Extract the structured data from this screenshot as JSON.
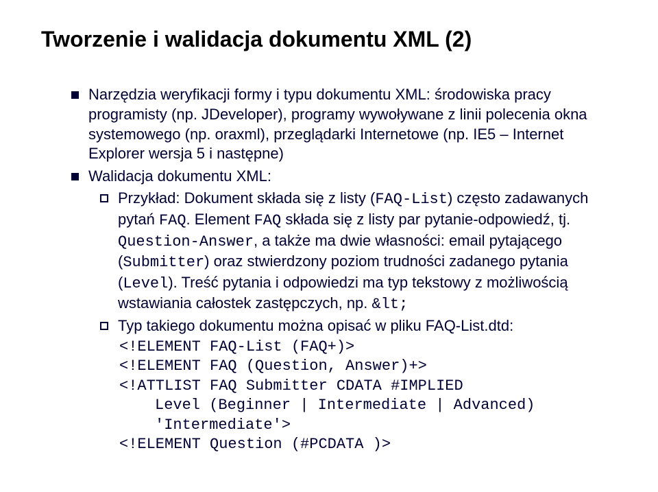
{
  "title": "Tworzenie i walidacja dokumentu XML (2)",
  "bullets": {
    "b1": "Narzędzia weryfikacji formy i typu dokumentu XML: środowiska pracy programisty (np. JDeveloper), programy wywoływane z linii polecenia okna systemowego (np. oraxml), przeglądarki Internetowe (np. IE5 – Internet Explorer wersja 5 i następne)",
    "b2": "Walidacja dokumentu XML:"
  },
  "sub": {
    "s1_prefix": "Przykład: Dokument składa się z listy (",
    "s1_code1": "FAQ-List",
    "s1_mid1": ") często zadawanych pytań ",
    "s1_code2": "FAQ",
    "s1_mid2": ". Element ",
    "s1_code3": "FAQ",
    "s1_mid3": " składa się z listy par pytanie-odpowiedź, tj. ",
    "s1_code4": "Question-Answer",
    "s1_mid4": ", a także ma dwie własności: email pytającego (",
    "s1_code5": "Submitter",
    "s1_mid5": ") oraz stwierdzony poziom trudności zadanego pytania (",
    "s1_code6": "Level",
    "s1_mid6": "). Treść pytania i odpowiedzi ma typ tekstowy z możliwością wstawiania całostek zastępczych, np. ",
    "s1_code7": "&lt;",
    "s2": "Typ takiego dokumentu można opisać w pliku FAQ-List.dtd:"
  },
  "code": {
    "l1": "<!ELEMENT FAQ-List (FAQ+)>",
    "l2": "<!ELEMENT FAQ (Question, Answer)+>",
    "l3": "<!ATTLIST FAQ Submitter CDATA #IMPLIED",
    "l4": "Level (Beginner | Intermediate | Advanced)",
    "l5": "'Intermediate'>",
    "l6": "<!ELEMENT Question (#PCDATA )>"
  }
}
